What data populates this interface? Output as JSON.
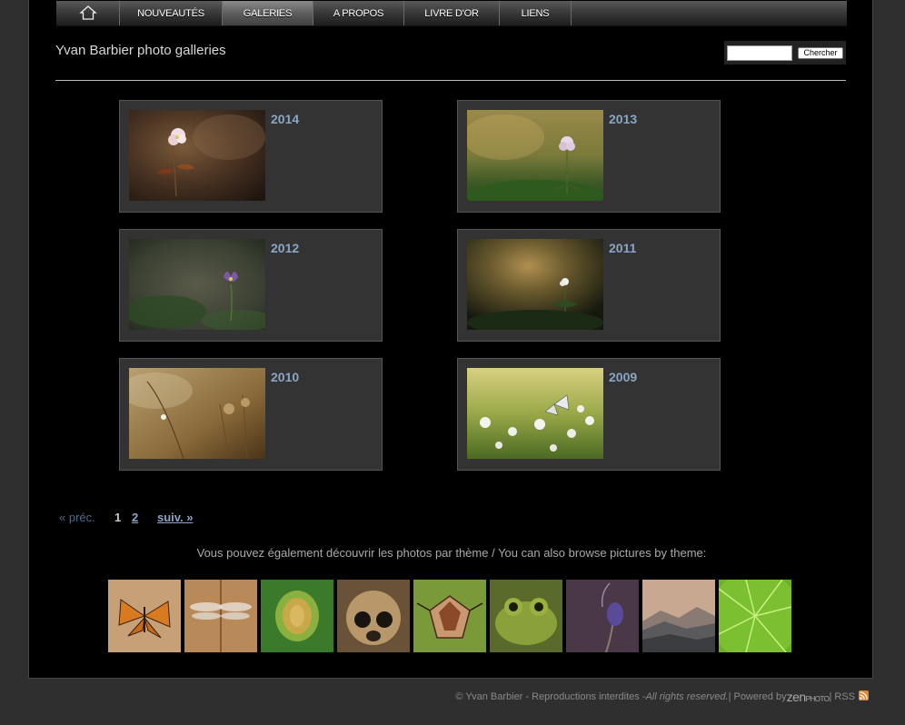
{
  "nav": {
    "items": [
      {
        "label": "NOUVEAUTÉS",
        "width": 113
      },
      {
        "label": "GALERIES",
        "width": 100,
        "active": true
      },
      {
        "label": "A PROPOS",
        "width": 100
      },
      {
        "label": "LIVRE D'OR",
        "width": 105
      },
      {
        "label": "LIENS",
        "width": 79
      }
    ]
  },
  "header": {
    "title": "Yvan Barbier photo galleries",
    "search_placeholder": "",
    "search_value": "",
    "search_button": "Chercher"
  },
  "albums": [
    {
      "year": "2014"
    },
    {
      "year": "2013"
    },
    {
      "year": "2012"
    },
    {
      "year": "2011"
    },
    {
      "year": "2010"
    },
    {
      "year": "2009"
    }
  ],
  "pagination": {
    "prev": "« préc.",
    "pages": [
      "1",
      "2"
    ],
    "next": "suiv. »"
  },
  "themes_text": "Vous pouvez également découvrir les photos par thème / You can also browse pictures by theme:",
  "footer": {
    "copyright": "© Yvan Barbier - Reproductions interdites - ",
    "rights": "All rights reserved.",
    "powered": " | Powered by ",
    "zen": "zen",
    "photo": "PHOTO",
    "rss": " | RSS"
  },
  "colors": {
    "link": "#8aa6c4",
    "panel": "#333333",
    "background": "#000000",
    "rss": "#e6862a"
  }
}
